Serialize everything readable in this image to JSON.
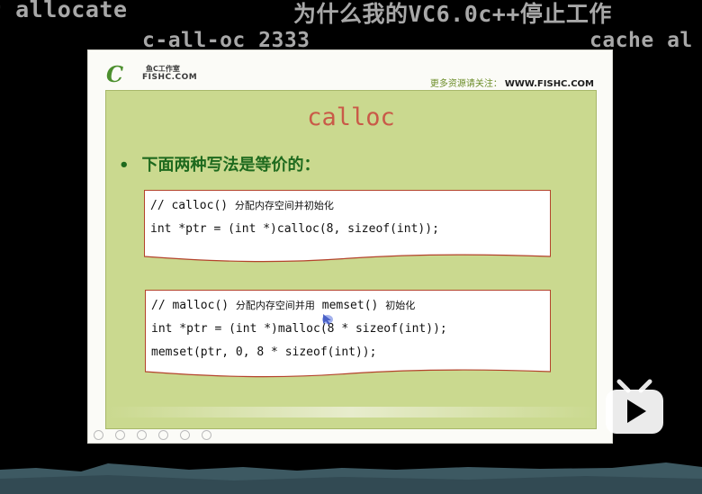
{
  "danmaku": [
    {
      "text": "r allocate"
    },
    {
      "text": "为什么我的VC6.0c++停止工作"
    },
    {
      "text": "c-all-oc  2333"
    },
    {
      "text": "cache al"
    }
  ],
  "slide": {
    "logo": {
      "mark": "C",
      "line1": "鱼C工作室",
      "line2": "FISHC.COM"
    },
    "header_right_cn": "更多资源请关注：",
    "header_right_url": "WWW.FISHC.COM",
    "title": "calloc",
    "bullet": "下面两种写法是等价的：",
    "code_block_1": {
      "comment_code": "// calloc() ",
      "comment_cn": "分配内存空间并初始化",
      "line2": "int *ptr = (int *)calloc(8, sizeof(int));"
    },
    "code_block_2": {
      "comment_code": "// malloc() ",
      "comment_cn": "分配内存空间并用",
      "comment_code2": " memset() ",
      "comment_cn2": "初始化",
      "line2": "int *ptr = (int *)malloc(8 * sizeof(int));",
      "line3": "memset(ptr, 0, 8 * sizeof(int));"
    }
  },
  "colors": {
    "panel_green": "#cad98f",
    "title_red": "#c95a48",
    "bullet_green": "#1e6a1e"
  }
}
